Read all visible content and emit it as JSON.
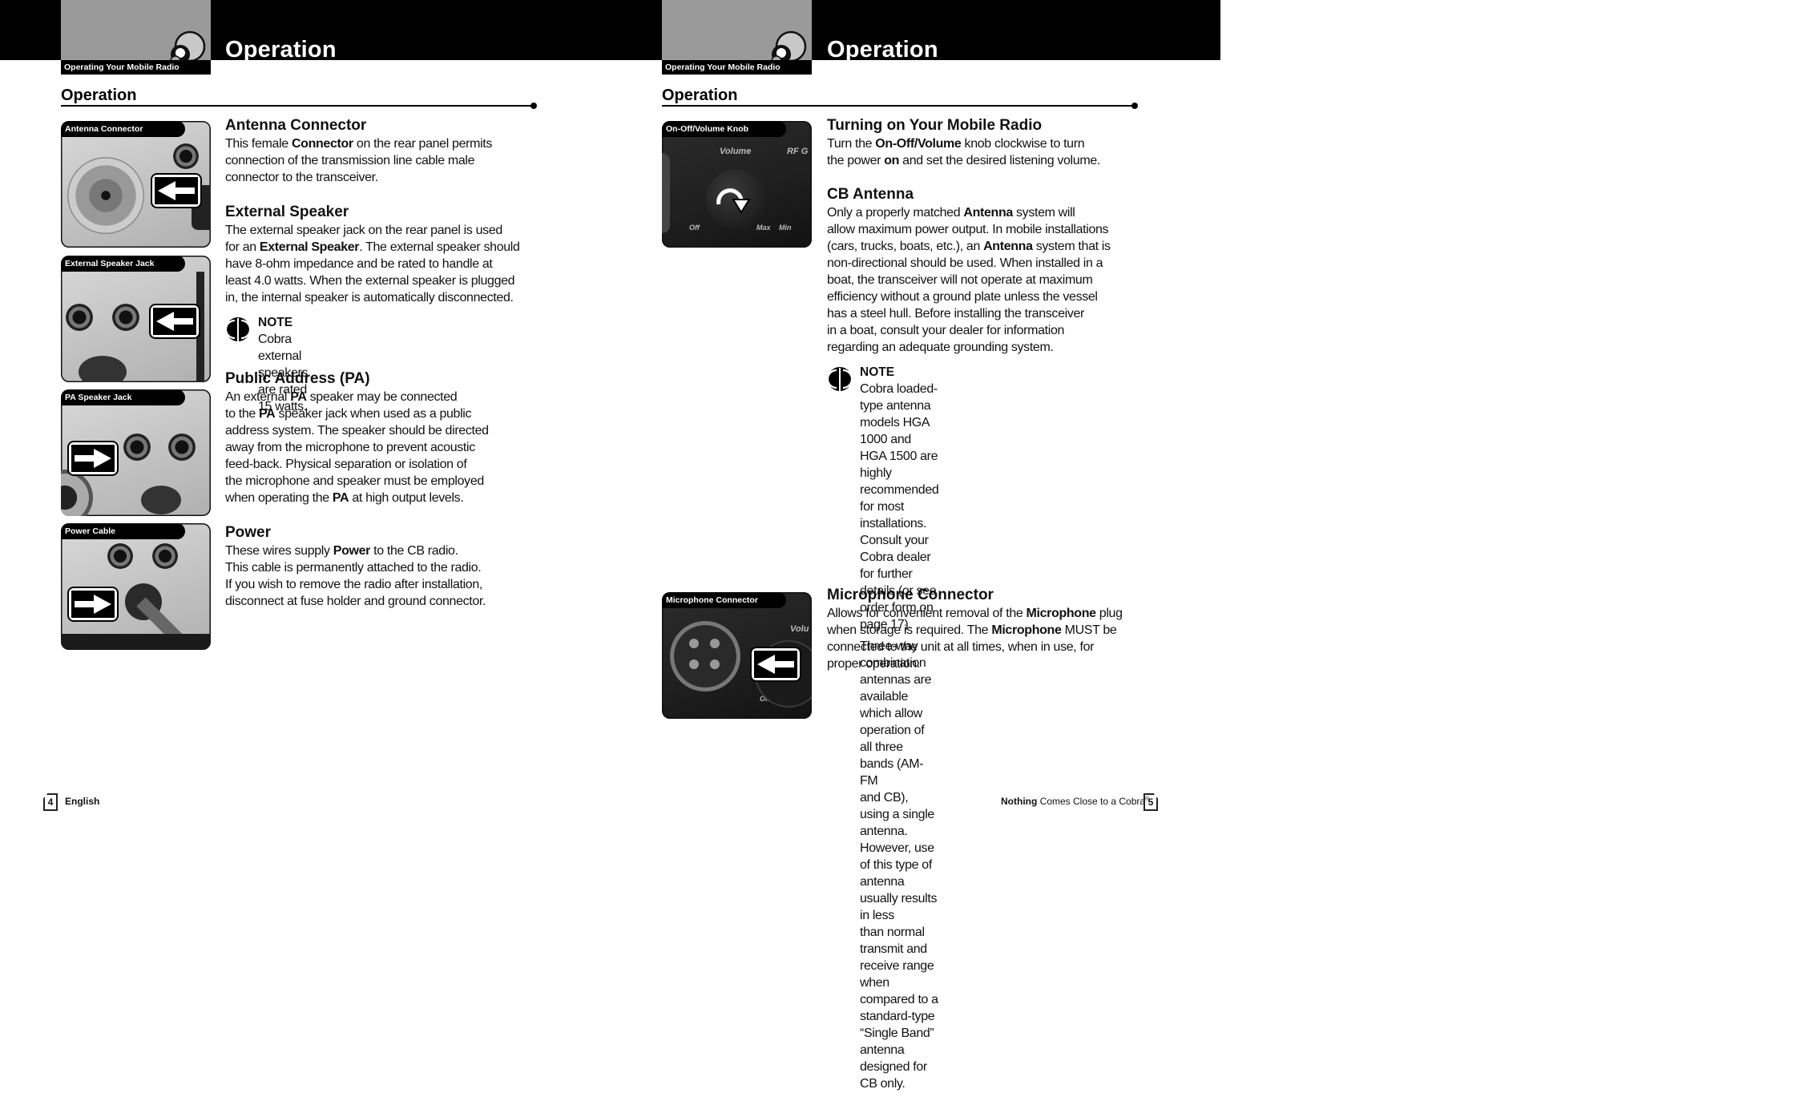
{
  "left_page": {
    "tab_label": "Operating Your Mobile Radio",
    "title": "Operation",
    "section_heading": "Operation",
    "photos": [
      {
        "label": "Antenna Connector",
        "arrow": "left-arrow-icon"
      },
      {
        "label": "External Speaker Jack",
        "arrow": "left-arrow-icon"
      },
      {
        "label": "PA Speaker Jack",
        "arrow": "right-arrow-icon"
      },
      {
        "label": "Power Cable",
        "arrow": "right-arrow-icon"
      }
    ],
    "sections": [
      {
        "heading": "Antenna Connector",
        "lines": [
          [
            {
              "t": "This female "
            },
            {
              "t": "Connector",
              "b": true
            },
            {
              "t": " on the rear panel permits"
            }
          ],
          [
            {
              "t": "connection of the transmission line cable male"
            }
          ],
          [
            {
              "t": "connector to the transceiver."
            }
          ]
        ]
      },
      {
        "heading": "External Speaker",
        "lines": [
          [
            {
              "t": "The external speaker jack on the rear panel is used"
            }
          ],
          [
            {
              "t": "for an "
            },
            {
              "t": "External Speaker",
              "b": true
            },
            {
              "t": ". The external speaker should"
            }
          ],
          [
            {
              "t": "have 8-ohm impedance and be rated to handle at"
            }
          ],
          [
            {
              "t": "least 4.0 watts. When the external speaker is plugged"
            }
          ],
          [
            {
              "t": "in, the internal speaker is automatically disconnected."
            }
          ]
        ]
      },
      {
        "heading": "Public Address (PA)",
        "lines": [
          [
            {
              "t": "An external "
            },
            {
              "t": "PA",
              "b": true
            },
            {
              "t": " speaker may be connected"
            }
          ],
          [
            {
              "t": "to the "
            },
            {
              "t": "PA",
              "b": true
            },
            {
              "t": " speaker jack when used as a public"
            }
          ],
          [
            {
              "t": "address system. The speaker should be directed"
            }
          ],
          [
            {
              "t": "away from the microphone to prevent acoustic"
            }
          ],
          [
            {
              "t": "feed-back. Physical separation or isolation of"
            }
          ],
          [
            {
              "t": "the microphone and speaker must be employed"
            }
          ],
          [
            {
              "t": "when operating the "
            },
            {
              "t": "PA",
              "b": true
            },
            {
              "t": " at high output levels."
            }
          ]
        ]
      },
      {
        "heading": "Power",
        "lines": [
          [
            {
              "t": "These wires supply "
            },
            {
              "t": "Power",
              "b": true
            },
            {
              "t": " to the CB radio."
            }
          ],
          [
            {
              "t": "This cable is permanently attached to the radio."
            }
          ],
          [
            {
              "t": "If you wish to remove the radio after installation,"
            }
          ],
          [
            {
              "t": "disconnect at fuse holder and ground connector."
            }
          ]
        ]
      }
    ],
    "note": {
      "title": "NOTE",
      "paragraphs": [
        "Cobra external speakers are rated 15 watts."
      ]
    },
    "footer": {
      "page_number": "4",
      "language": "English"
    }
  },
  "right_page": {
    "tab_label": "Operating Your Mobile Radio",
    "title": "Operation",
    "section_heading": "Operation",
    "photos": [
      {
        "label": "On-Off/Volume Knob",
        "arrow": "rotate-clockwise-icon",
        "knob_labels": [
          "Volume",
          "RF G",
          "Off",
          "Max",
          "Min"
        ]
      },
      {
        "label": "Microphone Connector",
        "arrow": "left-arrow-icon",
        "knob_labels": [
          "Volu",
          "Off"
        ]
      }
    ],
    "sections": [
      {
        "heading": "Turning on Your Mobile Radio",
        "lines": [
          [
            {
              "t": "Turn the "
            },
            {
              "t": "On-Off/Volume",
              "b": true
            },
            {
              "t": " knob clockwise to turn"
            }
          ],
          [
            {
              "t": "the power "
            },
            {
              "t": "on",
              "b": true
            },
            {
              "t": " and set the desired listening volume."
            }
          ]
        ]
      },
      {
        "heading": "CB Antenna",
        "lines": [
          [
            {
              "t": "Only a properly matched "
            },
            {
              "t": "Antenna",
              "b": true
            },
            {
              "t": " system will"
            }
          ],
          [
            {
              "t": "allow maximum power output. In mobile installations"
            }
          ],
          [
            {
              "t": "(cars, trucks, boats, etc.), an "
            },
            {
              "t": "Antenna",
              "b": true
            },
            {
              "t": " system that is"
            }
          ],
          [
            {
              "t": "non-directional should be used. When installed in a"
            }
          ],
          [
            {
              "t": "boat, the transceiver will not operate at maximum"
            }
          ],
          [
            {
              "t": "efficiency without a ground plate unless the vessel"
            }
          ],
          [
            {
              "t": "has a steel hull. Before installing the transceiver"
            }
          ],
          [
            {
              "t": "in a boat, consult your dealer for information"
            }
          ],
          [
            {
              "t": "regarding an adequate grounding system."
            }
          ]
        ]
      },
      {
        "heading": "Microphone Connector",
        "lines": [
          [
            {
              "t": "Allows for convenient removal of the "
            },
            {
              "t": "Microphone",
              "b": true
            },
            {
              "t": " plug"
            }
          ],
          [
            {
              "t": "when storage is required. The "
            },
            {
              "t": "Microphone",
              "b": true
            },
            {
              "t": " MUST be"
            }
          ],
          [
            {
              "t": "connected to the unit at all times, when in use, for"
            }
          ],
          [
            {
              "t": "proper operation."
            }
          ]
        ]
      }
    ],
    "note": {
      "title": "NOTE",
      "paragraphs": [
        "Cobra loaded-type antenna models HGA 1000 and\nHGA 1500 are highly recommended for most\ninstallations. Consult your Cobra dealer for further\ndetails (or see order form on page 17).",
        "Three-way combination antennas are available\nwhich allow operation of all three bands (AM-FM\nand CB), using a single antenna. However, use\nof this type of antenna usually results in less\nthan normal transmit and receive range when\ncompared to a standard-type “Single Band”\nantenna designed for CB only."
      ]
    },
    "footer": {
      "slogan_bold": "Nothing",
      "slogan_rest": " Comes Close to a Cobra",
      "registered": "®",
      "page_number": "5"
    }
  }
}
